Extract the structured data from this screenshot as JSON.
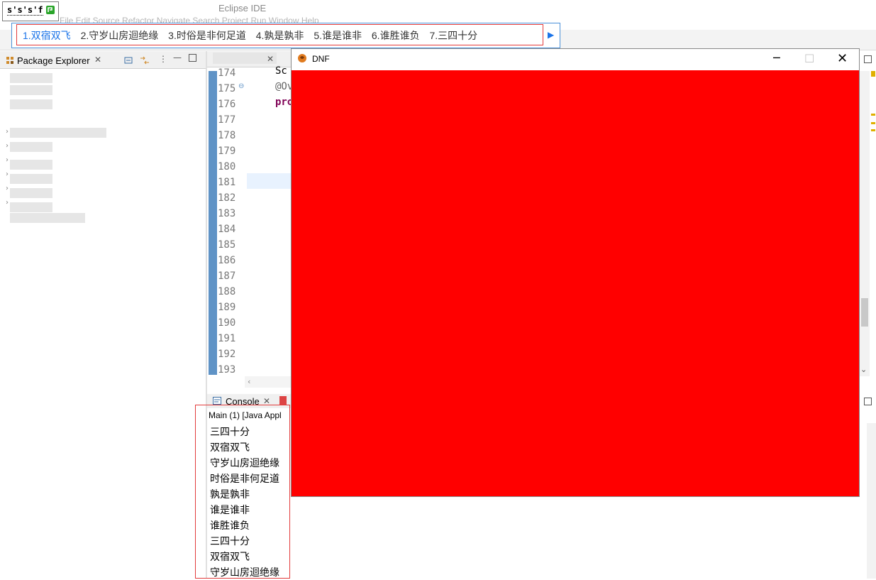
{
  "ime": {
    "composition": "s's's'f",
    "candidates": [
      "1.双宿双飞",
      "2.守岁山房迴绝缘",
      "3.时俗是非何足道",
      "4.孰是孰非",
      "5.谁是谁非",
      "6.谁胜谁负",
      "7.三四十分"
    ]
  },
  "window_title": "Eclipse IDE",
  "menu": "File  Edit  Source  Refactor  Navigate  Search  Project  Run  Window  Help",
  "package_explorer": {
    "title": "Package Explorer"
  },
  "editor": {
    "line_numbers": [
      "174",
      "175",
      "176",
      "177",
      "178",
      "179",
      "180",
      "181",
      "182",
      "183",
      "184",
      "185",
      "186",
      "187",
      "188",
      "189",
      "190",
      "191",
      "192",
      "193"
    ],
    "code_line_174": "Sc",
    "code_line_175": "@Ov",
    "code_line_176": "pro"
  },
  "console": {
    "title": "Console",
    "subtitle": "Main (1) [Java Appl",
    "lines": [
      "三四十分",
      "双宿双飞",
      "守岁山房迴绝缘",
      "时俗是非何足道",
      "孰是孰非",
      "谁是谁非",
      "谁胜谁负",
      "三四十分",
      "双宿双飞",
      "守岁山房迴绝缘"
    ]
  },
  "dnf_window": {
    "title": "DNF",
    "canvas_color": "#ff0000"
  },
  "colors": {
    "accent_blue": "#4a90d9",
    "highlight_red": "#e23b3b"
  }
}
